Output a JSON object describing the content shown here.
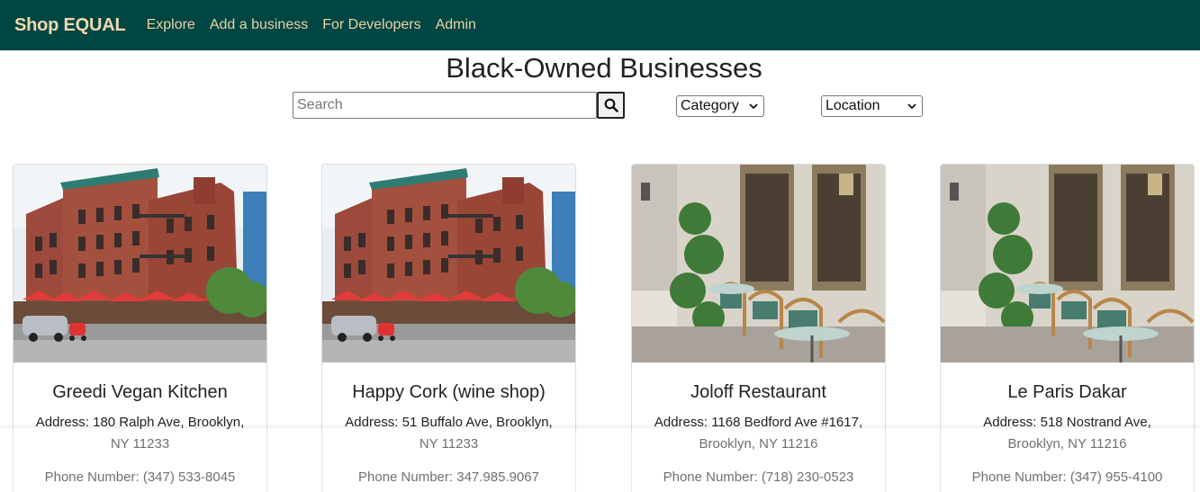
{
  "nav": {
    "brand": "Shop EQUAL",
    "links": [
      "Explore",
      "Add a business",
      "For Developers",
      "Admin"
    ]
  },
  "page": {
    "title": "Black-Owned Businesses"
  },
  "search": {
    "placeholder": "Search",
    "icon": "search-icon"
  },
  "filters": {
    "category": "Category",
    "location": "Location"
  },
  "colors": {
    "navbar": "#004643",
    "nav_text": "#e8d2a6"
  },
  "cards": [
    {
      "name": "Greedi Vegan Kitchen",
      "address": "Address: 180 Ralph Ave, Brooklyn, NY 11233",
      "phone": "Phone Number: (347) 533-8045",
      "image": "brick-building-photo"
    },
    {
      "name": "Happy Cork (wine shop)",
      "address": "Address: 51 Buffalo Ave, Brooklyn, NY 11233",
      "phone": "Phone Number: 347.985.9067",
      "image": "brick-building-photo"
    },
    {
      "name": "Joloff Restaurant",
      "address": "Address: 1168 Bedford Ave #1617, Brooklyn, NY 11216",
      "phone": "Phone Number: (718) 230-0523",
      "image": "cafe-terrace-photo"
    },
    {
      "name": "Le Paris Dakar",
      "address": "Address: 518 Nostrand Ave, Brooklyn, NY 11216",
      "phone": "Phone Number: (347) 955-4100",
      "image": "cafe-terrace-photo"
    }
  ]
}
